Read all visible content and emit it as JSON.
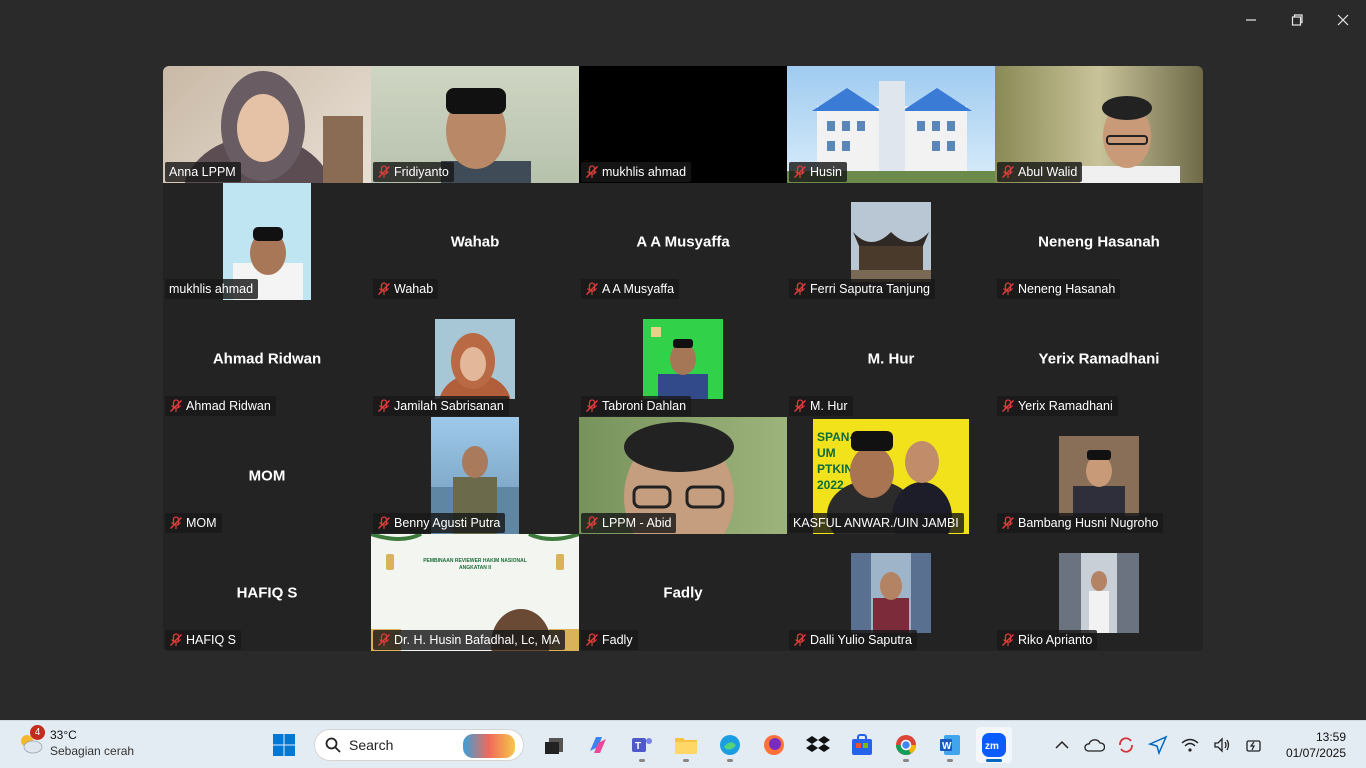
{
  "window": {
    "minimize_icon": "minimize-icon",
    "restore_icon": "restore-icon",
    "close_icon": "close-icon"
  },
  "participants": [
    {
      "name": "Anna LPPM",
      "muted": false,
      "video": "woman-hijab"
    },
    {
      "name": "Fridiyanto",
      "muted": true,
      "video": "man-peci"
    },
    {
      "name": "mukhlis ahmad",
      "muted": true,
      "video": "black"
    },
    {
      "name": "Husin",
      "muted": true,
      "video": "building"
    },
    {
      "name": "Abul Walid",
      "muted": true,
      "video": "man-glasses"
    },
    {
      "name": "mukhlis ahmad",
      "muted": false,
      "video": "thumb-man-peci"
    },
    {
      "name": "Wahab",
      "muted": true,
      "display": "Wahab"
    },
    {
      "name": "A A Musyaffa",
      "muted": true,
      "display": "A A Musyaffa"
    },
    {
      "name": "Ferri Saputra Tanjung",
      "muted": true,
      "video": "thumb-rumah-gadang"
    },
    {
      "name": "Neneng Hasanah",
      "muted": true,
      "display": "Neneng Hasanah"
    },
    {
      "name": "Ahmad Ridwan",
      "muted": true,
      "display": "Ahmad Ridwan"
    },
    {
      "name": "Jamilah Sabrisanan",
      "muted": true,
      "video": "thumb-woman-hijab"
    },
    {
      "name": "Tabroni Dahlan",
      "muted": true,
      "video": "thumb-man-green"
    },
    {
      "name": "M. Hur",
      "muted": true,
      "display": "M. Hur"
    },
    {
      "name": "Yerix Ramadhani",
      "muted": true,
      "display": "Yerix Ramadhani"
    },
    {
      "name": "MOM",
      "muted": true,
      "display": "MOM"
    },
    {
      "name": "Benny Agusti Putra",
      "muted": true,
      "video": "thumb-man-beach"
    },
    {
      "name": "LPPM - Abid",
      "muted": true,
      "video": "man-glasses-green"
    },
    {
      "name": "KASFUL ANWAR./UIN JAMBI",
      "muted": false,
      "active": true,
      "video": "speaker-banner"
    },
    {
      "name": "Bambang Husni Nugroho",
      "muted": true,
      "video": "thumb-man-suit"
    },
    {
      "name": "HAFIQ S",
      "muted": true,
      "display": "HAFIQ S"
    },
    {
      "name": "Dr. H. Husin Bafadhal, Lc, MA",
      "muted": true,
      "video": "event-poster"
    },
    {
      "name": "Fadly",
      "muted": true,
      "display": "Fadly"
    },
    {
      "name": "Dalli Yulio Saputra",
      "muted": true,
      "video": "thumb-man-store"
    },
    {
      "name": "Riko Aprianto",
      "muted": true,
      "video": "thumb-man-library"
    }
  ],
  "taskbar": {
    "weather_badge": "4",
    "weather_temp": "33°C",
    "weather_desc": "Sebagian cerah",
    "search_placeholder": "Search",
    "time": "13:59",
    "date": "01/07/2025",
    "accent": "#0067c0"
  }
}
